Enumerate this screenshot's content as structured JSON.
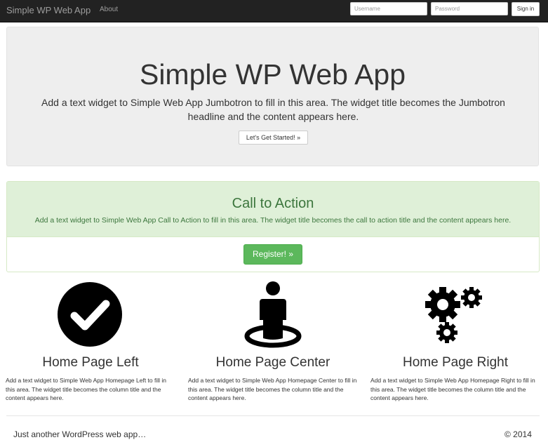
{
  "navbar": {
    "brand": "Simple WP Web App",
    "links": [
      {
        "label": "About"
      }
    ],
    "username_placeholder": "Username",
    "password_placeholder": "Password",
    "signin_label": "Sign in"
  },
  "jumbotron": {
    "title": "Simple WP Web App",
    "text": "Add a text widget to Simple Web App Jumbotron to fill in this area. The widget title becomes the Jumbotron headline and the content appears here.",
    "button_label": "Let's Get Started! »"
  },
  "call_to_action": {
    "title": "Call to Action",
    "text": "Add a text widget to Simple Web App Call to Action to fill in this area. The widget title becomes the call to action title and the content appears here.",
    "button_label": "Register! »",
    "colors": {
      "panel_bg": "#dff0d8",
      "text": "#3c763d",
      "button": "#5cb85c"
    }
  },
  "columns": [
    {
      "icon": "check-circle-icon",
      "title": "Home Page Left",
      "text": "Add a text widget to Simple Web App Homepage Left to fill in this area. The widget title becomes the column title and the content appears here."
    },
    {
      "icon": "person-location-icon",
      "title": "Home Page Center",
      "text": "Add a text widget to Simple Web App Homepage Center to fill in this area. The widget title becomes the column title and the content appears here."
    },
    {
      "icon": "gears-icon",
      "title": "Home Page Right",
      "text": "Add a text widget to Simple Web App Homepage Right to fill in this area. The widget title becomes the column title and the content appears here."
    }
  ],
  "footer": {
    "tagline": "Just another WordPress web app…",
    "copyright": "© 2014"
  }
}
